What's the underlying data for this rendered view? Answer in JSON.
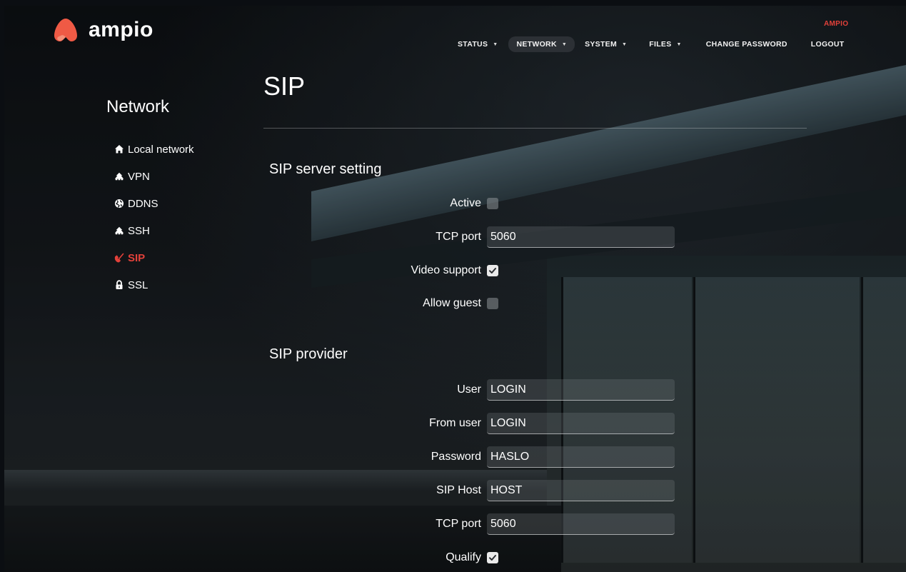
{
  "brand": {
    "logo_text": "ampio",
    "logo_color": "#ef5a45",
    "accent_color": "#e2413a"
  },
  "header": {
    "user_name": "AMPIO",
    "nav": [
      {
        "label": "STATUS",
        "has_dropdown": true,
        "active": false
      },
      {
        "label": "NETWORK",
        "has_dropdown": true,
        "active": true
      },
      {
        "label": "SYSTEM",
        "has_dropdown": true,
        "active": false
      },
      {
        "label": "FILES",
        "has_dropdown": true,
        "active": false
      },
      {
        "label": "CHANGE PASSWORD",
        "has_dropdown": false,
        "active": false
      },
      {
        "label": "LOGOUT",
        "has_dropdown": false,
        "active": false
      }
    ],
    "caret_glyph": "▼"
  },
  "sidebar": {
    "title": "Network",
    "items": [
      {
        "label": "Local network",
        "icon": "home-icon",
        "active": false
      },
      {
        "label": "VPN",
        "icon": "sitemap-icon",
        "active": false
      },
      {
        "label": "DDNS",
        "icon": "globe-icon",
        "active": false
      },
      {
        "label": "SSH",
        "icon": "sitemap-icon",
        "active": false
      },
      {
        "label": "SIP",
        "icon": "phone-icon",
        "active": true
      },
      {
        "label": "SSL",
        "icon": "lock-icon",
        "active": false
      }
    ]
  },
  "main": {
    "title": "SIP",
    "server_section": {
      "title": "SIP server setting",
      "active_label": "Active",
      "active_checked": false,
      "tcp_port_label": "TCP port",
      "tcp_port_value": "5060",
      "video_support_label": "Video support",
      "video_support_checked": true,
      "allow_guest_label": "Allow guest",
      "allow_guest_checked": false
    },
    "provider_section": {
      "title": "SIP provider",
      "user_label": "User",
      "user_value": "LOGIN",
      "from_user_label": "From user",
      "from_user_value": "LOGIN",
      "password_label": "Password",
      "password_value": "HASLO",
      "sip_host_label": "SIP Host",
      "sip_host_value": "HOST",
      "tcp_port_label": "TCP port",
      "tcp_port_value": "5060",
      "qualify_label": "Qualify",
      "qualify_checked": true
    }
  }
}
